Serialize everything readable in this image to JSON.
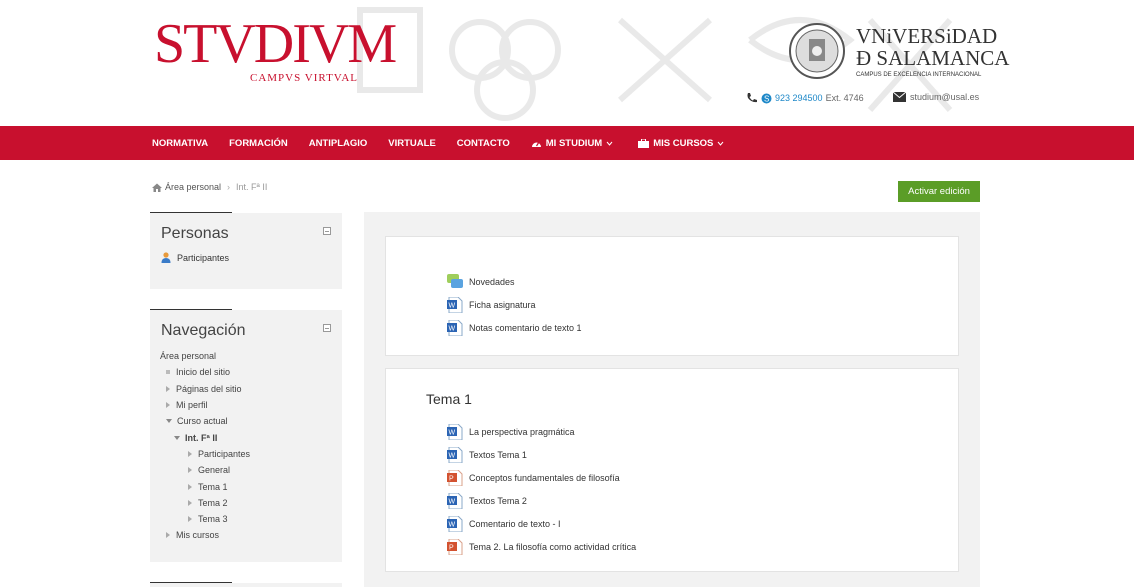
{
  "header": {
    "logo_main": "STVDIVM",
    "logo_sub": "CAMPVS VIRTVAL",
    "university_line1": "VNiVERSiDAD",
    "university_line2": "Ð SALAMANCA",
    "university_tagline": "CAMPUS DE EXCELENCIA INTERNACIONAL",
    "phone": "923 294500",
    "phone_ext": "Ext. 4746",
    "email": "studium@usal.es"
  },
  "nav": {
    "items": [
      "NORMATIVA",
      "FORMACIÓN",
      "ANTIPLAGIO",
      "VIRTUALE",
      "CONTACTO",
      "MI STUDIUM",
      "MIS CURSOS"
    ]
  },
  "breadcrumb": {
    "home": "Área personal",
    "current": "Int. Fª II"
  },
  "edit_button": "Activar edición",
  "personas": {
    "title": "Personas",
    "participants": "Participantes"
  },
  "navegacion": {
    "title": "Navegación",
    "root": "Área personal",
    "items": [
      "Inicio del sitio",
      "Páginas del sitio",
      "Mi perfil",
      "Curso actual",
      "Int. Fª II",
      "Participantes",
      "General",
      "Tema 1",
      "Tema 2",
      "Tema 3",
      "Mis cursos"
    ]
  },
  "section0": {
    "activities": [
      "Novedades",
      "Ficha asignatura",
      "Notas comentario de texto 1"
    ]
  },
  "section1": {
    "title": "Tema 1",
    "activities": [
      "La perspectiva pragmática",
      "Textos Tema 1",
      "Conceptos fundamentales de filosofía",
      "Textos Tema 2",
      "Comentario de texto - I",
      "Tema 2. La filosofía como actividad crítica"
    ]
  },
  "colors": {
    "brand_red": "#c8102e",
    "edit_green": "#5b9d27",
    "link_blue": "#1e88c8"
  }
}
